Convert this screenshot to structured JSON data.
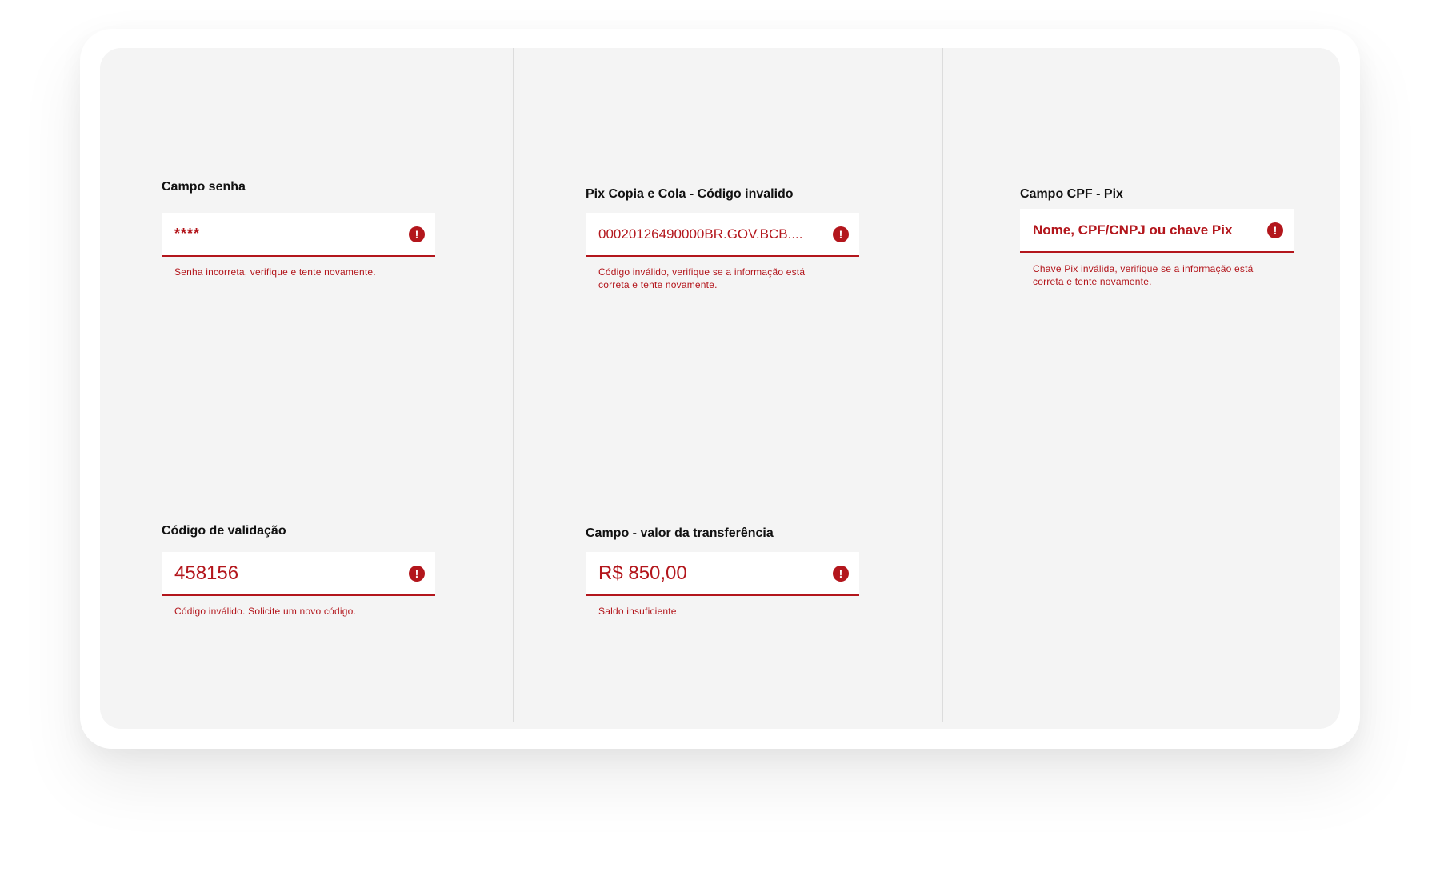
{
  "fields": [
    {
      "title": "Campo senha",
      "value": "****",
      "helper": "Senha incorreta, verifique e tente novamente."
    },
    {
      "title": "Pix Copia e Cola - Código invalido",
      "value": "00020126490000BR.GOV.BCB....",
      "helper": "Código inválido, verifique se a informação está correta e tente novamente."
    },
    {
      "title": "Campo CPF - Pix",
      "value": "Nome, CPF/CNPJ ou chave Pix",
      "helper": "Chave Pix inválida, verifique se a informação está correta e tente novamente."
    },
    {
      "title": "Código de validação",
      "value": "458156",
      "helper": "Código inválido. Solicite um novo código."
    },
    {
      "title": "Campo - valor da transferência",
      "value": "R$ 850,00",
      "helper": "Saldo insuficiente"
    }
  ],
  "icons": {
    "error": "alert-circle-icon",
    "error_glyph": "!"
  },
  "colors": {
    "error": "#b3161c",
    "panel_background": "#f4f4f4",
    "title": "#111111"
  }
}
